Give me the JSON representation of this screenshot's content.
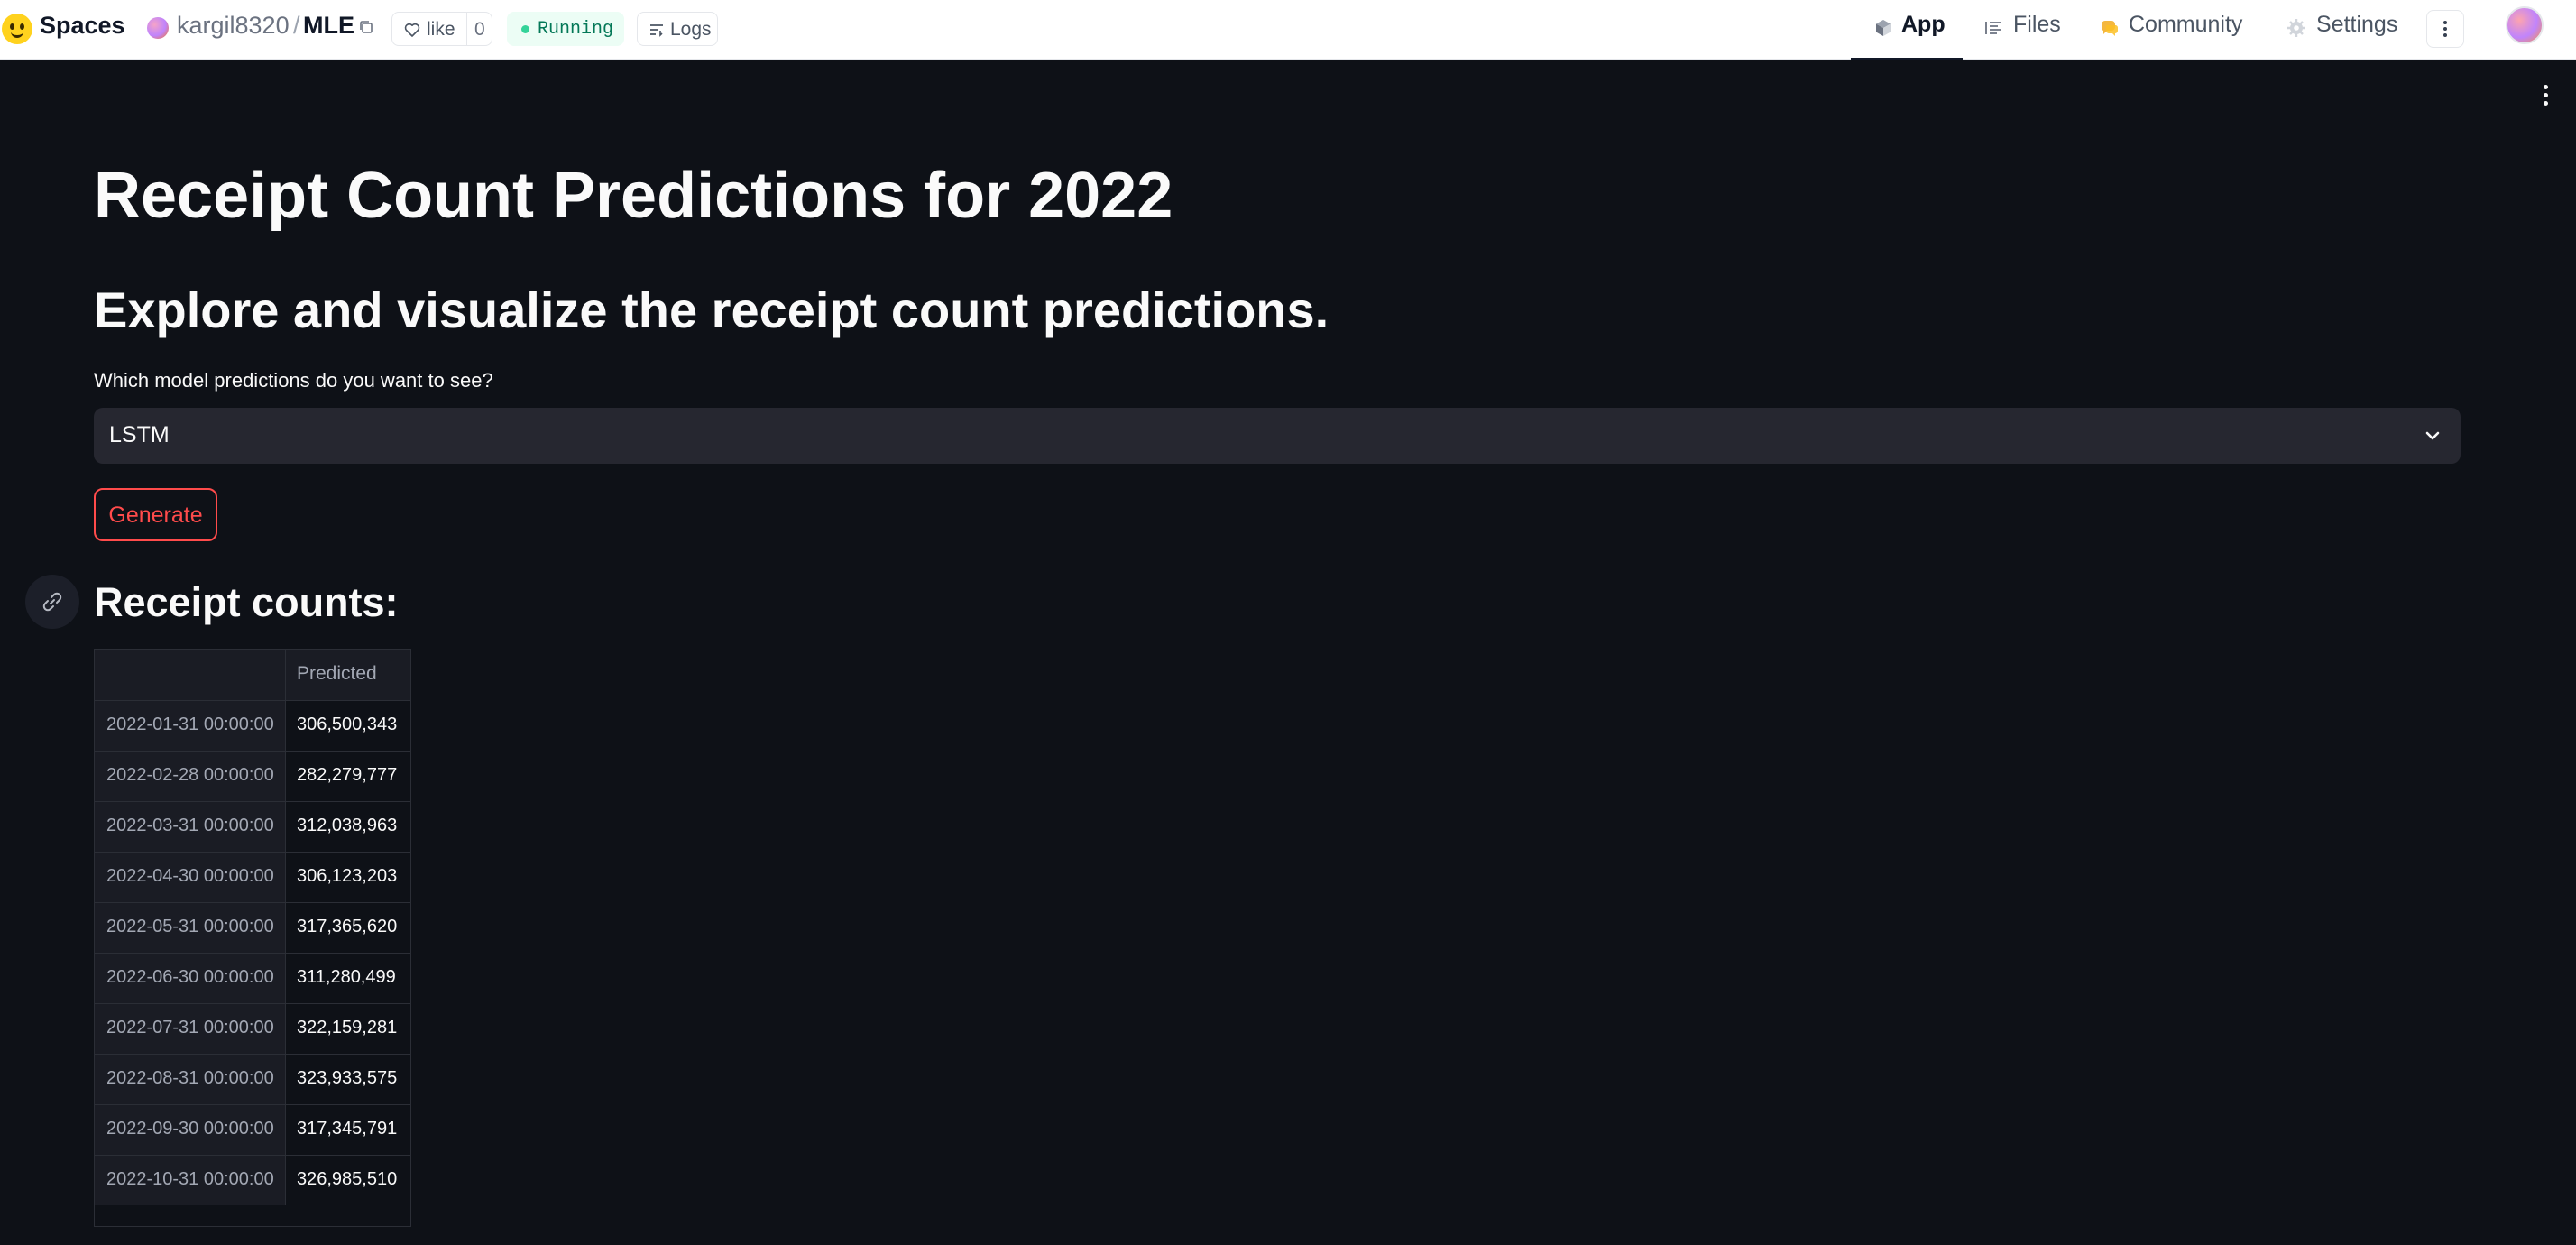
{
  "topbar": {
    "brand": "Spaces",
    "owner": "kargil8320",
    "separator": "/",
    "repo": "MLE",
    "like_label": "like",
    "like_count": "0",
    "status": "Running",
    "logs_label": "Logs",
    "tabs": [
      {
        "label": "App",
        "icon": "app-cube-icon",
        "active": true
      },
      {
        "label": "Files",
        "icon": "files-icon",
        "active": false
      },
      {
        "label": "Community",
        "icon": "community-icon",
        "active": false
      },
      {
        "label": "Settings",
        "icon": "gear-icon",
        "active": false
      }
    ]
  },
  "colors": {
    "background": "#0e1117",
    "accent": "#ff4b4b",
    "status_green": "#047857",
    "select_bg": "#262730"
  },
  "main": {
    "title": "Receipt Count Predictions for 2022",
    "subtitle": "Explore and visualize the receipt count predictions.",
    "select_label": "Which model predictions do you want to see?",
    "select_value": "LSTM",
    "generate_label": "Generate",
    "section_header": "Receipt counts:"
  },
  "table": {
    "columns": [
      "",
      "Predicted"
    ],
    "rows": [
      {
        "date": "2022-01-31 00:00:00",
        "predicted": "306,500,343"
      },
      {
        "date": "2022-02-28 00:00:00",
        "predicted": "282,279,777"
      },
      {
        "date": "2022-03-31 00:00:00",
        "predicted": "312,038,963"
      },
      {
        "date": "2022-04-30 00:00:00",
        "predicted": "306,123,203"
      },
      {
        "date": "2022-05-31 00:00:00",
        "predicted": "317,365,620"
      },
      {
        "date": "2022-06-30 00:00:00",
        "predicted": "311,280,499"
      },
      {
        "date": "2022-07-31 00:00:00",
        "predicted": "322,159,281"
      },
      {
        "date": "2022-08-31 00:00:00",
        "predicted": "323,933,575"
      },
      {
        "date": "2022-09-30 00:00:00",
        "predicted": "317,345,791"
      },
      {
        "date": "2022-10-31 00:00:00",
        "predicted": "326,985,510"
      }
    ]
  }
}
